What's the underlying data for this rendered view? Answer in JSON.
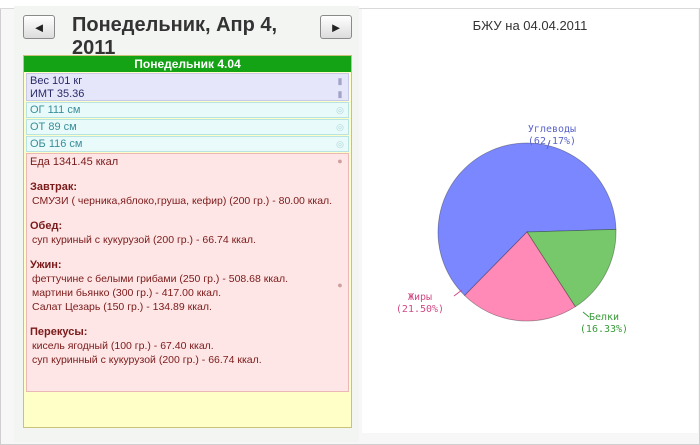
{
  "nav": {
    "prev_label": "◄",
    "next_label": "►",
    "date_title": "Понедельник, Апр 4, 2011"
  },
  "day": {
    "header": "Понедельник 4.04",
    "weight": "Вес 101 кг",
    "bmi": "ИМТ 35.36",
    "measurements": [
      "ОГ 111 см",
      "ОТ 89 см",
      "ОБ 116 см"
    ],
    "food_total": "Еда 1341.45 ккал",
    "meals": [
      {
        "name": "Завтрак:",
        "items": [
          "СМУЗИ ( черника,яблоко,груша, кефир) (200 гр.) - 80.00 ккал."
        ]
      },
      {
        "name": "Обед:",
        "items": [
          "суп куриный с кукурузой (200 гр.) - 66.74 ккал."
        ]
      },
      {
        "name": "Ужин:",
        "items": [
          "феттучине с белыми грибами (250 гр.) - 508.68 ккал.",
          "мартини бьянко (300 гр.) - 417.00 ккал.",
          "Салат Цезарь (150 гр.) - 134.89 ккал."
        ]
      },
      {
        "name": "Перекусы:",
        "items": [
          "кисель ягодный (100 гр.) - 67.40 ккал.",
          "суп куринный с кукурузой (200 гр.) - 66.74 ккал."
        ]
      }
    ]
  },
  "chart_data": {
    "type": "pie",
    "title": "БЖУ на 04.04.2011",
    "slices": [
      {
        "name": "Углеводы",
        "percent_label": "(62.17%)",
        "value": 62.17,
        "color": "#7b87ff",
        "label_color": "#5a64c8"
      },
      {
        "name": "Белки",
        "percent_label": "(16.33%)",
        "value": 16.33,
        "color": "#76c86a",
        "label_color": "#3a9a3a"
      },
      {
        "name": "Жиры",
        "percent_label": "(21.50%)",
        "value": 21.5,
        "color": "#ff8ab8",
        "label_color": "#d24a86"
      }
    ]
  },
  "colors": {
    "header_green": "#14a314",
    "day_bg": "#ffffc8",
    "weight_bg": "#e6e6fa",
    "meas_bg": "#e8fafa",
    "food_bg": "#ffe6e6"
  }
}
